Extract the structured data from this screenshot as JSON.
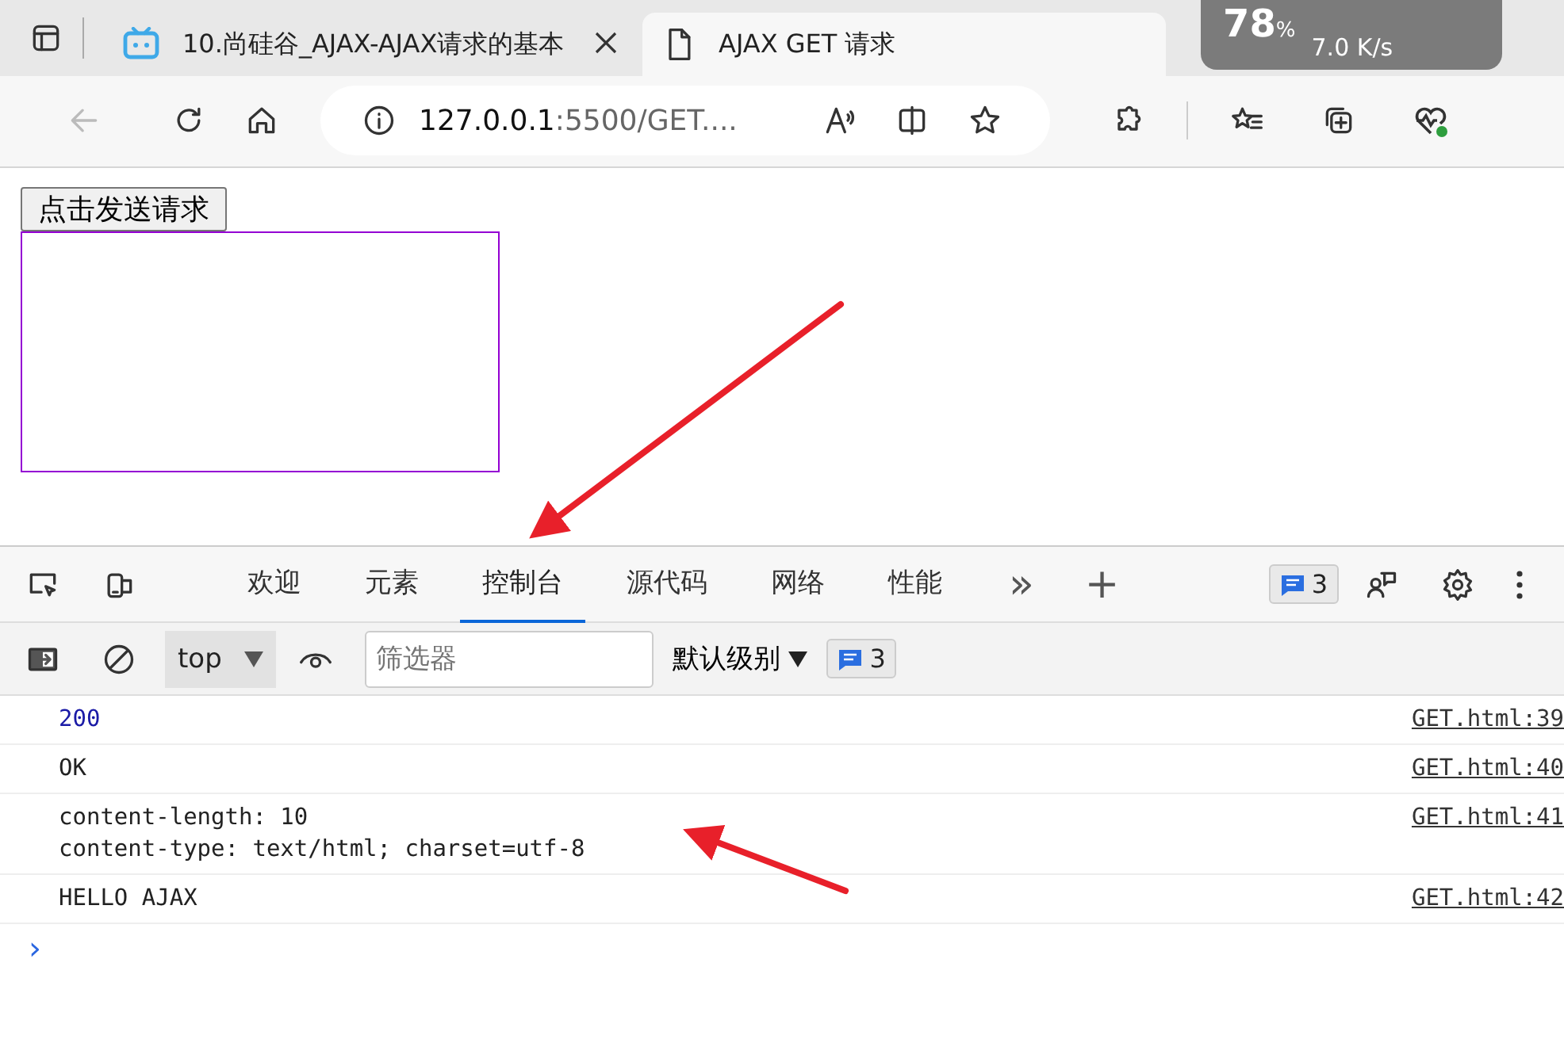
{
  "browser": {
    "tabs": [
      {
        "title": "10.尚硅谷_AJAX-AJAX请求的基本",
        "selected": false,
        "kind": "video-site"
      },
      {
        "title": "AJAX GET 请求",
        "selected": true,
        "kind": "document"
      }
    ],
    "address": {
      "host": "127.0.0.1",
      "rest": ":5500/GET...."
    },
    "network_widget": {
      "percent": "78",
      "unit": "%",
      "download": "7.0 K/s"
    }
  },
  "page": {
    "button": "点击发送请求"
  },
  "devtools": {
    "tabs": [
      {
        "label": "欢迎",
        "selected": false
      },
      {
        "label": "元素",
        "selected": false
      },
      {
        "label": "控制台",
        "selected": true
      },
      {
        "label": "源代码",
        "selected": false
      },
      {
        "label": "网络",
        "selected": false
      },
      {
        "label": "性能",
        "selected": false
      }
    ],
    "more": "»",
    "add": "+",
    "issues_count": "3",
    "console": {
      "context": "top",
      "filter_placeholder": "筛选器",
      "levels": "默认级别",
      "message_count": "3",
      "messages": [
        {
          "kind": "number",
          "lines": [
            "200"
          ],
          "source": "GET.html:39"
        },
        {
          "kind": "text",
          "lines": [
            "OK"
          ],
          "source": "GET.html:40"
        },
        {
          "kind": "text",
          "lines": [
            "content-length: 10",
            "content-type: text/html; charset=utf-8"
          ],
          "source": "GET.html:41"
        },
        {
          "kind": "text",
          "lines": [
            "HELLO AJAX"
          ],
          "source": "GET.html:42"
        }
      ],
      "prompt": "›"
    }
  }
}
